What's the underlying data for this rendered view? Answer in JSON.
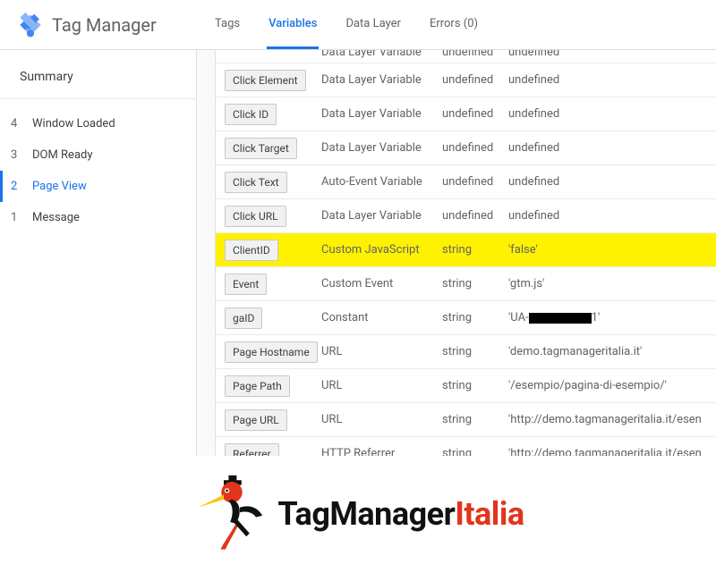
{
  "header": {
    "app_title": "Tag Manager",
    "tabs": [
      {
        "label": "Tags",
        "active": false
      },
      {
        "label": "Variables",
        "active": true
      },
      {
        "label": "Data Layer",
        "active": false
      },
      {
        "label": "Errors (0)",
        "active": false
      }
    ]
  },
  "sidebar": {
    "summary_label": "Summary",
    "events": [
      {
        "num": "4",
        "label": "Window Loaded",
        "active": false
      },
      {
        "num": "3",
        "label": "DOM Ready",
        "active": false
      },
      {
        "num": "2",
        "label": "Page View",
        "active": true
      },
      {
        "num": "1",
        "label": "Message",
        "active": false
      }
    ]
  },
  "variables": [
    {
      "name": "",
      "type": "Data Layer Variable",
      "ret": "undefined",
      "val": "undefined",
      "highlight": false,
      "clipped": true
    },
    {
      "name": "Click Element",
      "type": "Data Layer Variable",
      "ret": "undefined",
      "val": "undefined",
      "highlight": false
    },
    {
      "name": "Click ID",
      "type": "Data Layer Variable",
      "ret": "undefined",
      "val": "undefined",
      "highlight": false
    },
    {
      "name": "Click Target",
      "type": "Data Layer Variable",
      "ret": "undefined",
      "val": "undefined",
      "highlight": false
    },
    {
      "name": "Click Text",
      "type": "Auto-Event Variable",
      "ret": "undefined",
      "val": "undefined",
      "highlight": false
    },
    {
      "name": "Click URL",
      "type": "Data Layer Variable",
      "ret": "undefined",
      "val": "undefined",
      "highlight": false
    },
    {
      "name": "ClientID",
      "type": "Custom JavaScript",
      "ret": "string",
      "val": "'false'",
      "highlight": true
    },
    {
      "name": "Event",
      "type": "Custom Event",
      "ret": "string",
      "val": "'gtm.js'",
      "highlight": false
    },
    {
      "name": "gaID",
      "type": "Constant",
      "ret": "string",
      "val": "REDACTED",
      "highlight": false
    },
    {
      "name": "Page Hostname",
      "type": "URL",
      "ret": "string",
      "val": "'demo.tagmanageritalia.it'",
      "highlight": false
    },
    {
      "name": "Page Path",
      "type": "URL",
      "ret": "string",
      "val": "'/esempio/pagina-di-esempio/'",
      "highlight": false
    },
    {
      "name": "Page URL",
      "type": "URL",
      "ret": "string",
      "val": "'http://demo.tagmanageritalia.it/esen",
      "highlight": false
    },
    {
      "name": "Referrer",
      "type": "HTTP Referrer",
      "ret": "string",
      "val": "'http://demo.tagmanageritalia.it/esen",
      "highlight": false
    }
  ],
  "footer": {
    "brand_part1": "TagManager",
    "brand_part2": "Italia"
  }
}
